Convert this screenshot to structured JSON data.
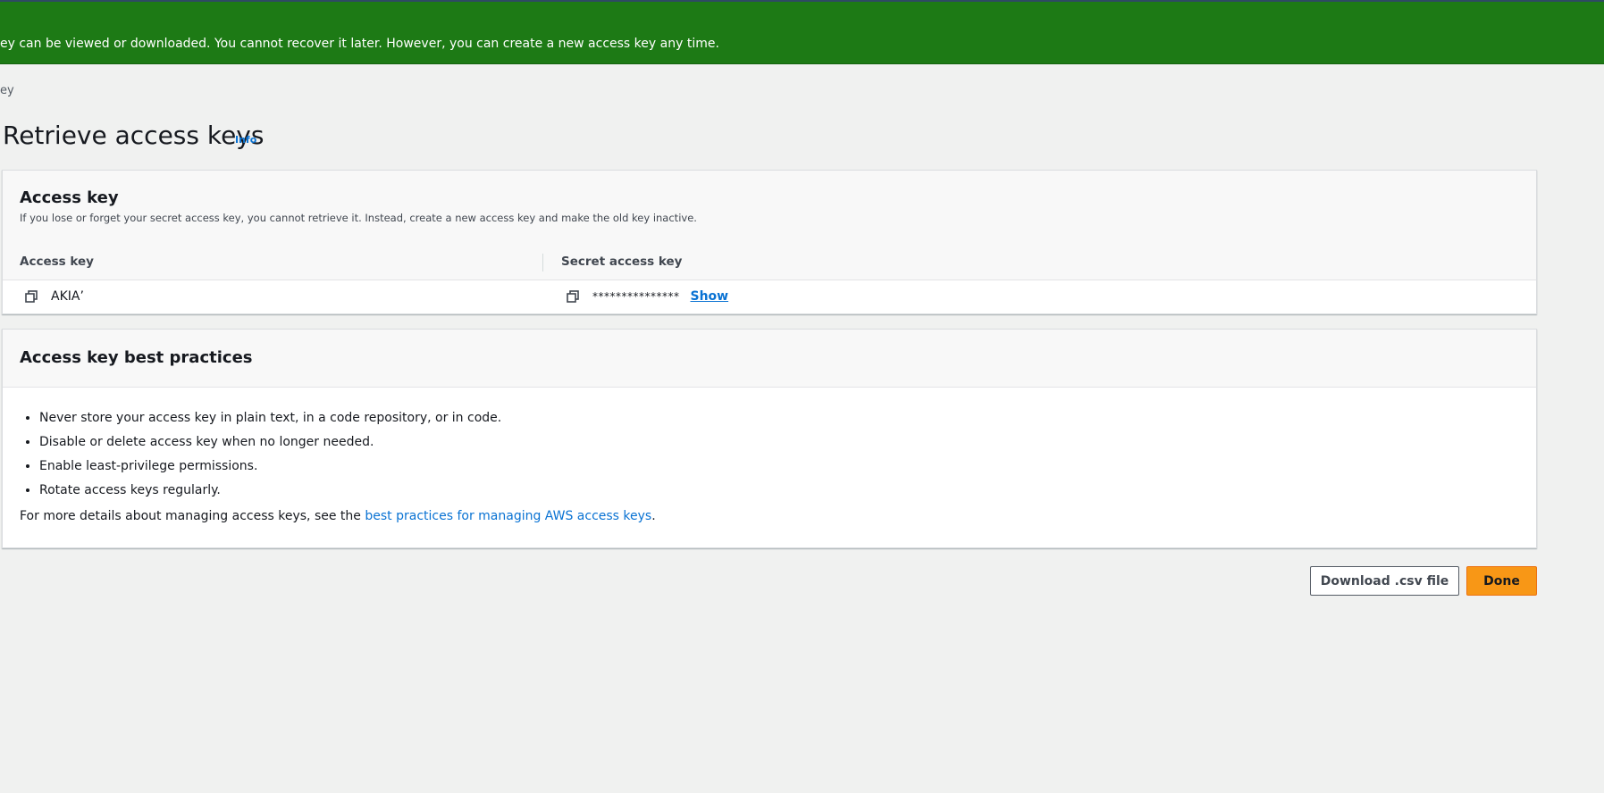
{
  "banner": {
    "message": "ey can be viewed or downloaded. You cannot recover it later. However, you can create a new access key any time."
  },
  "breadcrumb": {
    "current": "ey"
  },
  "page": {
    "title": "Retrieve access keys",
    "info_label": "Info"
  },
  "access_key_panel": {
    "title": "Access key",
    "description": "If you lose or forget your secret access key, you cannot retrieve it. Instead, create a new access key and make the old key inactive.",
    "columns": [
      "Access key",
      "Secret access key"
    ],
    "row": {
      "access_key": "AKIA’",
      "secret_masked": "***************",
      "show_label": "Show"
    }
  },
  "best_practices_panel": {
    "title": "Access key best practices",
    "items": [
      "Never store your access key in plain text, in a code repository, or in code.",
      "Disable or delete access key when no longer needed.",
      "Enable least-privilege permissions.",
      "Rotate access keys regularly."
    ],
    "details_prefix": "For more details about managing access keys, see the ",
    "details_link": "best practices for managing AWS access keys",
    "details_suffix": "."
  },
  "actions": {
    "download_label": "Download .csv file",
    "done_label": "Done"
  },
  "colors": {
    "banner_green": "#1d7a15",
    "link_blue": "#0972d3",
    "primary_orange": "#f89716"
  }
}
